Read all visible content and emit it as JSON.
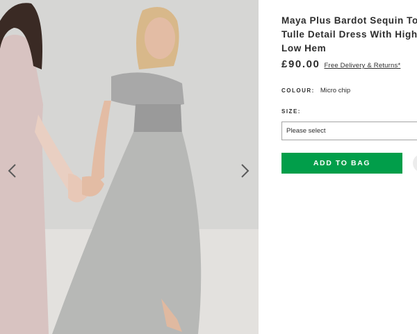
{
  "product": {
    "title_lines": [
      "Maya Plus Bardot Sequin Top",
      "Tulle Detail Dress With High",
      "Low Hem"
    ],
    "price": "£90.00",
    "delivery_link": "Free Delivery & Returns*",
    "colour_label": "COLOUR:",
    "colour_value": "Micro chip",
    "size_label": "SIZE:",
    "size_placeholder": "Please select",
    "add_to_bag": "ADD TO BAG"
  },
  "gallery": {
    "prev_icon": "chevron-left-icon",
    "next_icon": "chevron-right-icon"
  },
  "colors": {
    "accent_green": "#019e4a",
    "text": "#2d2d2d",
    "border": "#a4a4a4"
  }
}
